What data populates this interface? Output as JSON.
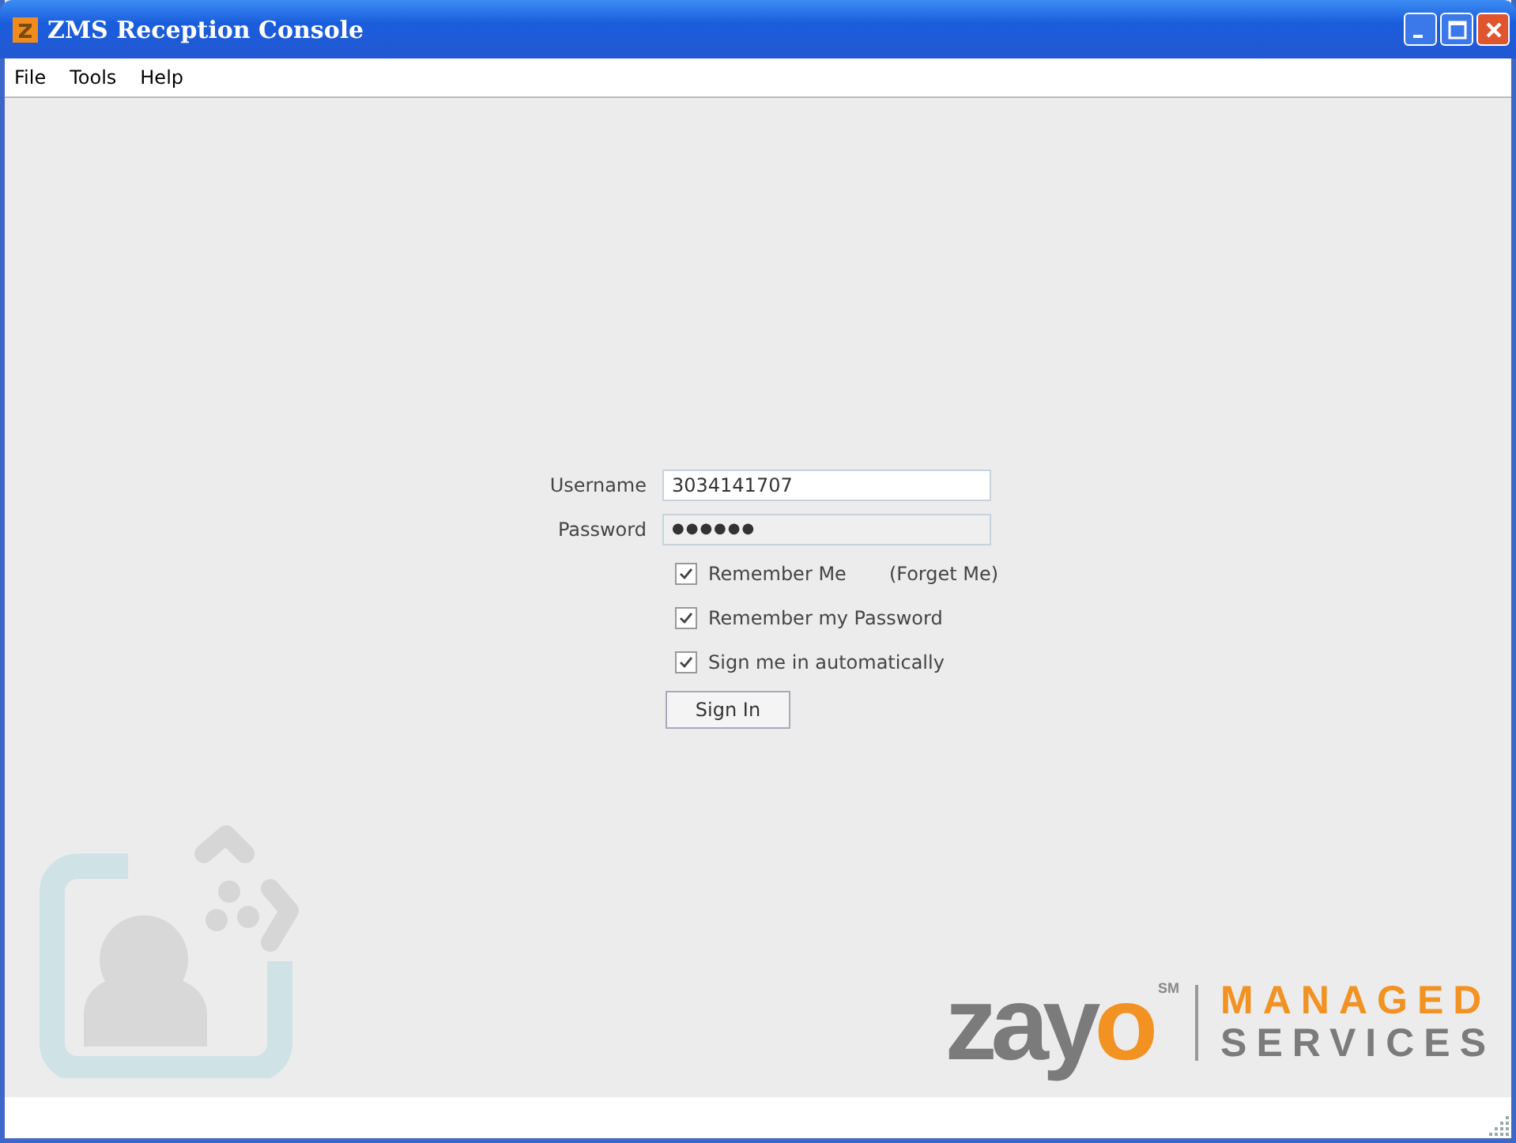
{
  "window": {
    "title": "ZMS Reception Console"
  },
  "menu": [
    "File",
    "Tools",
    "Help"
  ],
  "form": {
    "fields": [
      {
        "label": "Username",
        "value": "3034141707",
        "disabled": false
      },
      {
        "label": "Password",
        "value": "●●●●●●",
        "disabled": true
      }
    ],
    "options": [
      {
        "label": "Remember Me",
        "checked": true,
        "link": "(Forget Me)"
      },
      {
        "label": "Remember my Password",
        "checked": true
      },
      {
        "label": "Sign me in automatically",
        "checked": true
      }
    ],
    "button": "Sign In"
  },
  "logo": {
    "word": "zayo",
    "mark": "SM",
    "line1": "MANAGED",
    "line2": "SERVICES"
  }
}
